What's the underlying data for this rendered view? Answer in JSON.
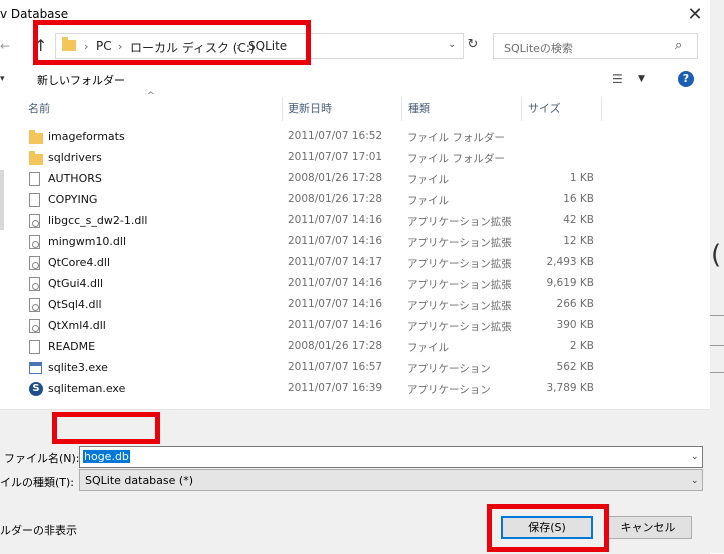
{
  "window": {
    "title": "v Database",
    "close_glyph": "✕"
  },
  "nav": {
    "back_glyph": "←",
    "up_glyph": "↑",
    "breadcrumbs": [
      "PC",
      "ローカル ディスク (C:)",
      "SQLite"
    ],
    "search_placeholder": "SQLiteの検索"
  },
  "toolbar": {
    "new_folder": "新しいフォルダー"
  },
  "columns": {
    "name": "名前",
    "date": "更新日時",
    "type": "種類",
    "size": "サイズ"
  },
  "files": [
    {
      "name": "imageformats",
      "date": "2011/07/07 16:52",
      "type": "ファイル フォルダー",
      "size": "",
      "icon": "folder-icon"
    },
    {
      "name": "sqldrivers",
      "date": "2011/07/07 17:01",
      "type": "ファイル フォルダー",
      "size": "",
      "icon": "folder-icon"
    },
    {
      "name": "AUTHORS",
      "date": "2008/01/26 17:28",
      "type": "ファイル",
      "size": "1 KB",
      "icon": "file-icon"
    },
    {
      "name": "COPYING",
      "date": "2008/01/26 17:28",
      "type": "ファイル",
      "size": "16 KB",
      "icon": "file-icon"
    },
    {
      "name": "libgcc_s_dw2-1.dll",
      "date": "2011/07/07 14:16",
      "type": "アプリケーション拡張",
      "size": "42 KB",
      "icon": "dll-icon"
    },
    {
      "name": "mingwm10.dll",
      "date": "2011/07/07 14:16",
      "type": "アプリケーション拡張",
      "size": "12 KB",
      "icon": "dll-icon"
    },
    {
      "name": "QtCore4.dll",
      "date": "2011/07/07 14:17",
      "type": "アプリケーション拡張",
      "size": "2,493 KB",
      "icon": "dll-icon"
    },
    {
      "name": "QtGui4.dll",
      "date": "2011/07/07 14:16",
      "type": "アプリケーション拡張",
      "size": "9,619 KB",
      "icon": "dll-icon"
    },
    {
      "name": "QtSql4.dll",
      "date": "2011/07/07 14:16",
      "type": "アプリケーション拡張",
      "size": "266 KB",
      "icon": "dll-icon"
    },
    {
      "name": "QtXml4.dll",
      "date": "2011/07/07 14:16",
      "type": "アプリケーション拡張",
      "size": "390 KB",
      "icon": "dll-icon"
    },
    {
      "name": "README",
      "date": "2008/01/26 17:28",
      "type": "ファイル",
      "size": "2 KB",
      "icon": "file-icon"
    },
    {
      "name": "sqlite3.exe",
      "date": "2011/07/07 16:57",
      "type": "アプリケーション",
      "size": "562 KB",
      "icon": "exe-icon"
    },
    {
      "name": "sqliteman.exe",
      "date": "2011/07/07 16:39",
      "type": "アプリケーション",
      "size": "3,789 KB",
      "icon": "sqliteman-icon"
    }
  ],
  "bottom": {
    "filename_label": "ファイル名(N):",
    "filename_value": "hoge.db",
    "filetype_label": "イルの種類(T):",
    "filetype_value": "SQLite database (*)",
    "hide_folders": "ルダーの非表示",
    "save": "保存(S)",
    "cancel": "キャンセル"
  }
}
